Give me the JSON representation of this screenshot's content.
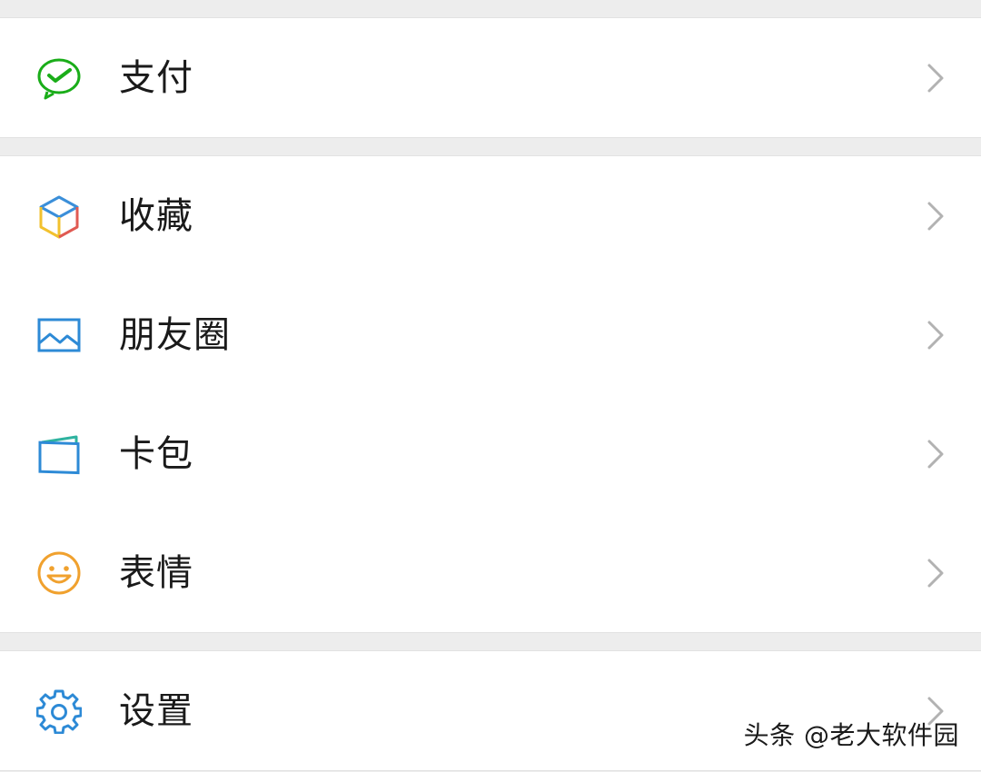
{
  "menu": {
    "groups": [
      {
        "items": [
          {
            "label": "支付",
            "icon": "pay-icon",
            "icon_color": "#1aad19"
          }
        ]
      },
      {
        "items": [
          {
            "label": "收藏",
            "icon": "favorites-cube-icon",
            "icon_color": "#3b8fd9"
          },
          {
            "label": "朋友圈",
            "icon": "moments-picture-icon",
            "icon_color": "#2d8ad6"
          },
          {
            "label": "卡包",
            "icon": "card-wallet-icon",
            "icon_color": "#2d8ad6"
          },
          {
            "label": "表情",
            "icon": "smiley-icon",
            "icon_color": "#f0a12e"
          }
        ]
      },
      {
        "items": [
          {
            "label": "设置",
            "icon": "gear-icon",
            "icon_color": "#2d8ad6"
          }
        ]
      }
    ]
  },
  "watermark": "头条 @老大软件园",
  "colors": {
    "background": "#ededed",
    "row": "#ffffff",
    "text": "#1a1a1a",
    "chevron": "#b2b2b2"
  }
}
